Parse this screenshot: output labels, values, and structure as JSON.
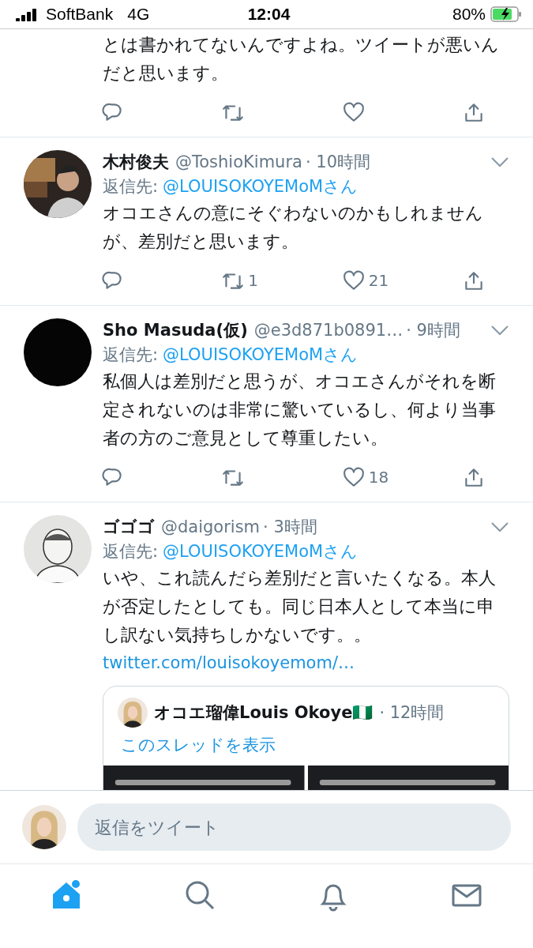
{
  "status_bar": {
    "carrier": "SoftBank",
    "network": "4G",
    "time": "12:04",
    "battery": "80%"
  },
  "tweets": [
    {
      "body": "とは書かれてないんですよね。ツイートが悪いんだと思います。"
    },
    {
      "name": "木村俊夫",
      "handle": "@ToshioKimura",
      "time": "· 10時間",
      "reply_label": "返信先:",
      "reply_to": "@LOUISOKOYEMoMさん",
      "body": "オコエさんの意にそぐわないのかもしれませんが、差別だと思います。",
      "actions": {
        "retweet": "1",
        "like": "21"
      }
    },
    {
      "name": "Sho Masuda(仮)",
      "handle": "@e3d871b0891…",
      "time": "· 9時間",
      "reply_label": "返信先:",
      "reply_to": "@LOUISOKOYEMoMさん",
      "body": "私個人は差別だと思うが、オコエさんがそれを断定されないのは非常に驚いているし、何より当事者の方のご意見として尊重したい。",
      "actions": {
        "like": "18"
      }
    },
    {
      "name": "ゴゴゴ",
      "handle": "@daigorism",
      "time": "· 3時間",
      "reply_label": "返信先:",
      "reply_to": "@LOUISOKOYEMoMさん",
      "body": "いや、これ読んだら差別だと言いたくなる。本人が否定したとしても。同じ日本人として本当に申し訳ない気持ちしかないです。。",
      "link": "twitter.com/louisokoyemom/…",
      "quote": {
        "name": "オコエ瑠偉Louis Okoye🇳🇬",
        "time": "· 12時間",
        "thread_link": "このスレッドを表示"
      }
    }
  ],
  "compose": {
    "placeholder": "返信をツイート"
  },
  "tabs": [
    {
      "selected": true
    },
    {
      "selected": false
    },
    {
      "selected": false
    },
    {
      "selected": false
    }
  ]
}
